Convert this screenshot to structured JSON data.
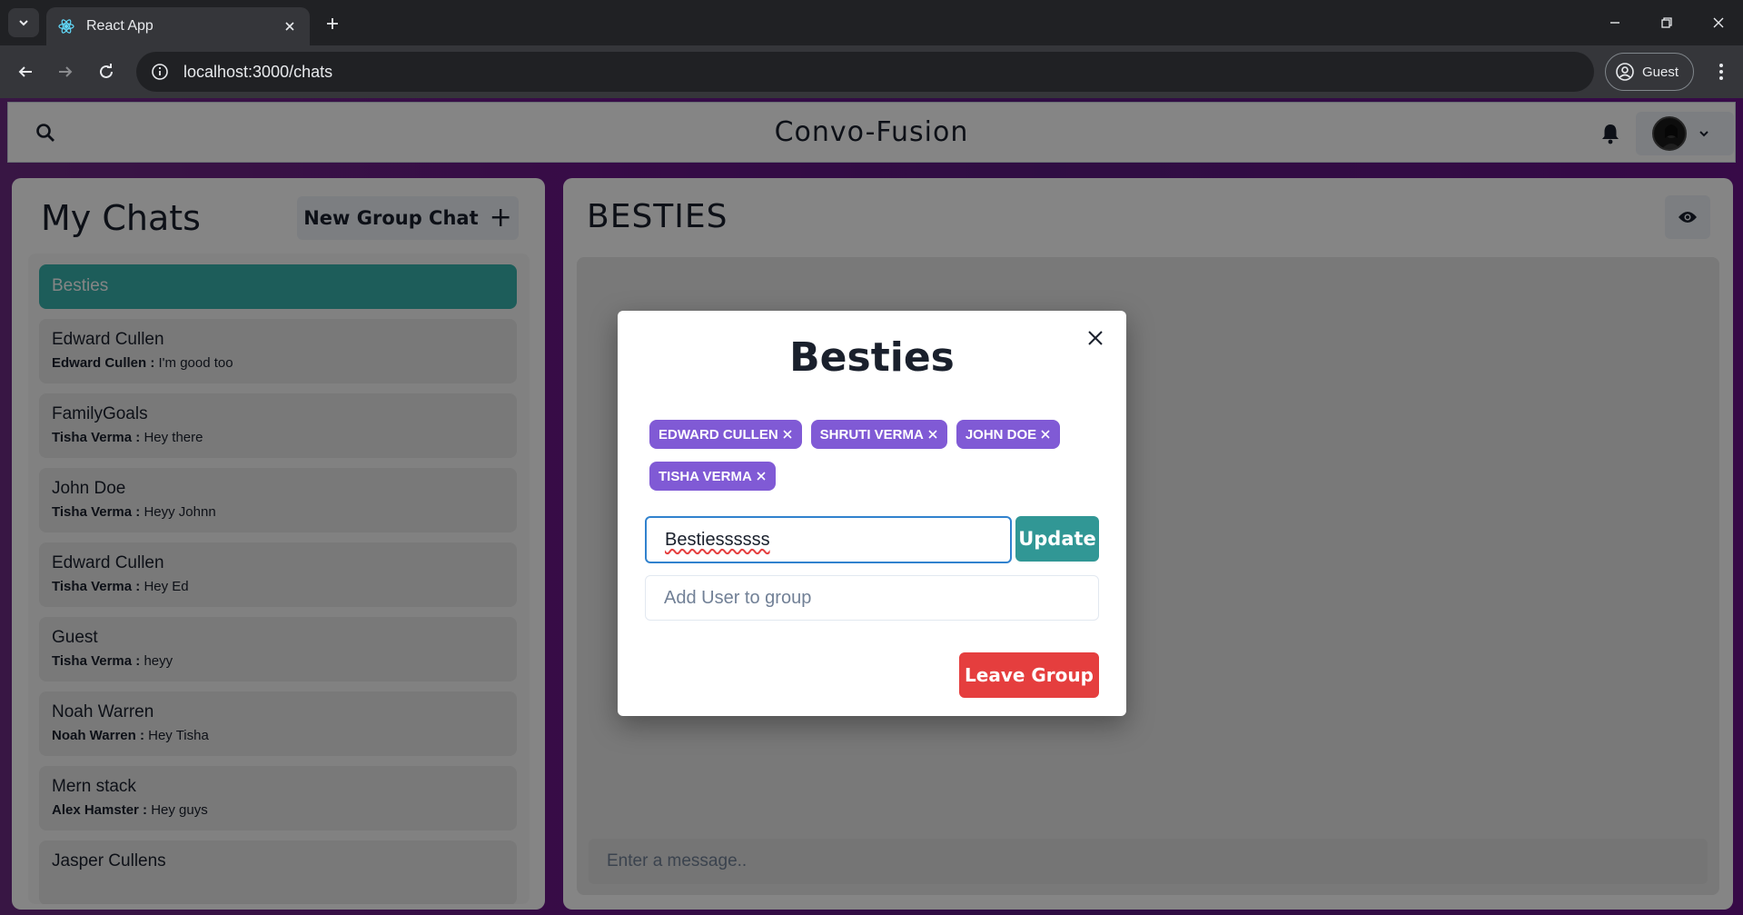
{
  "browser": {
    "tab_title": "React App",
    "url": "localhost:3000/chats",
    "profile_label": "Guest"
  },
  "header": {
    "brand": "Convo-Fusion"
  },
  "sidebar": {
    "title": "My Chats",
    "new_group_label": "New Group Chat",
    "chats": [
      {
        "name": "Besties",
        "sender": "",
        "message": "",
        "selected": true
      },
      {
        "name": "Edward Cullen",
        "sender": "Edward Cullen :",
        "message": "I'm good too"
      },
      {
        "name": "FamilyGoals",
        "sender": "Tisha Verma :",
        "message": "Hey there"
      },
      {
        "name": "John Doe",
        "sender": "Tisha Verma :",
        "message": "Heyy Johnn"
      },
      {
        "name": "Edward Cullen",
        "sender": "Tisha Verma :",
        "message": "Hey Ed"
      },
      {
        "name": "Guest",
        "sender": "Tisha Verma :",
        "message": "heyy"
      },
      {
        "name": "Noah Warren",
        "sender": "Noah Warren :",
        "message": "Hey Tisha"
      },
      {
        "name": "Mern stack",
        "sender": "Alex Hamster :",
        "message": "Hey guys"
      },
      {
        "name": "Jasper Cullens",
        "sender": "",
        "message": ""
      }
    ]
  },
  "chat": {
    "title": "BESTIES",
    "message_placeholder": "Enter a message.."
  },
  "modal": {
    "title": "Besties",
    "members": [
      "EDWARD CULLEN",
      "SHRUTI VERMA",
      "JOHN DOE",
      "TISHA VERMA"
    ],
    "rename_value": "Bestiessssss",
    "update_label": "Update",
    "add_user_placeholder": "Add User to group",
    "leave_label": "Leave Group"
  },
  "colors": {
    "selected_chat": "#38b2ac",
    "badge": "#805ad5",
    "update_button": "#319795",
    "leave_button": "#e53e3e"
  }
}
